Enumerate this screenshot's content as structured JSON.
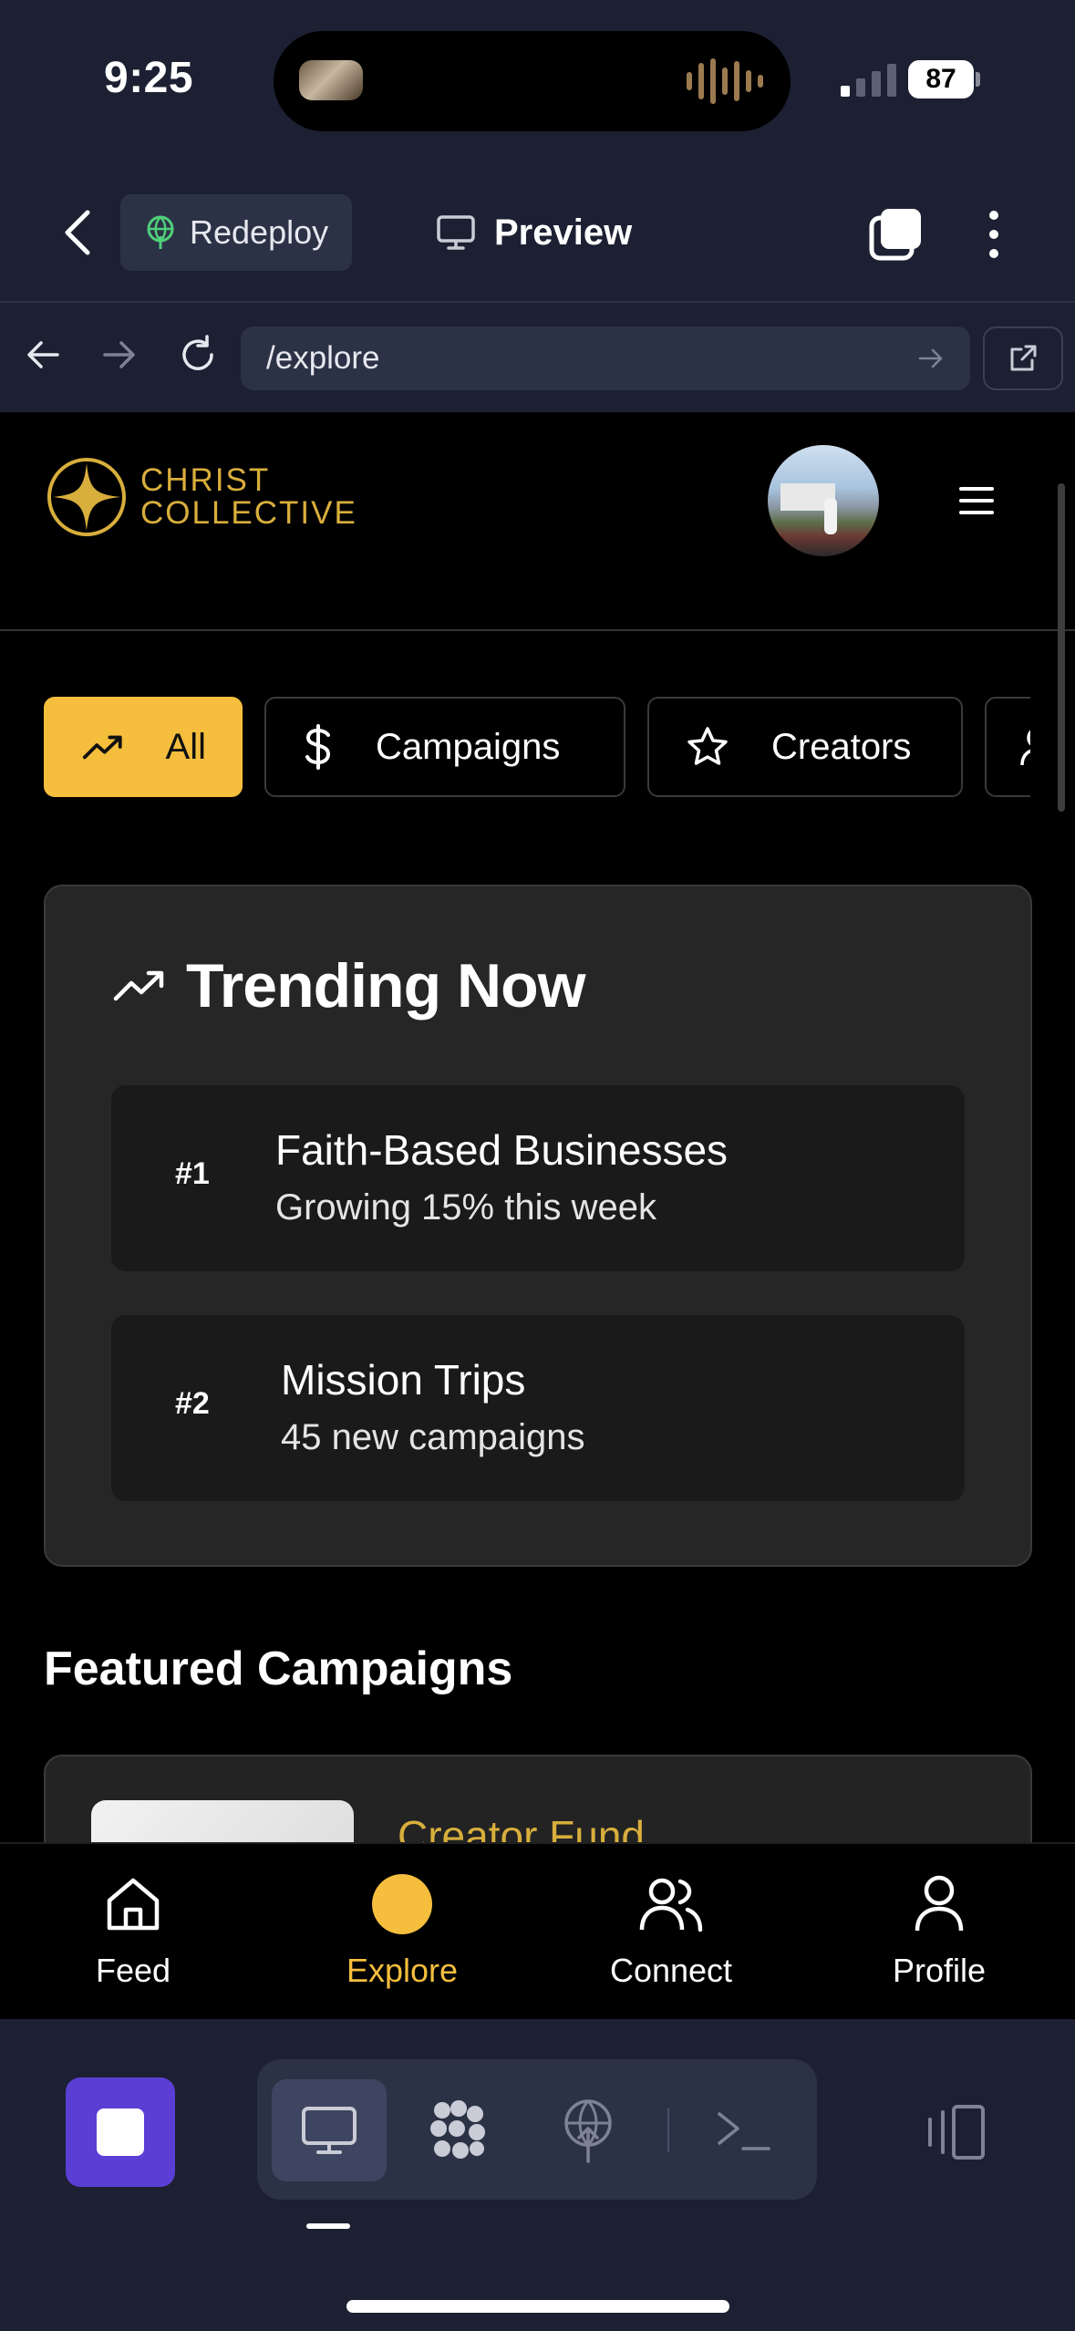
{
  "status_bar": {
    "time": "9:25",
    "battery": "87"
  },
  "topbar": {
    "redeploy_label": "Redeploy",
    "preview_label": "Preview"
  },
  "url_bar": {
    "path": "/explore"
  },
  "app": {
    "logo_line1": "CHRIST",
    "logo_line2": "COLLECTIVE",
    "brand_color": "#d8ae3c",
    "accent_color": "#f5be3d"
  },
  "filters": [
    {
      "label": "All",
      "icon": "trending-up-icon",
      "active": true
    },
    {
      "label": "Campaigns",
      "icon": "dollar-icon",
      "active": false
    },
    {
      "label": "Creators",
      "icon": "star-icon",
      "active": false
    }
  ],
  "trending": {
    "title": "Trending Now",
    "items": [
      {
        "rank": "#1",
        "name": "Faith-Based Businesses",
        "detail": "Growing 15% this week"
      },
      {
        "rank": "#2",
        "name": "Mission Trips",
        "detail": "45 new campaigns"
      }
    ]
  },
  "featured": {
    "heading": "Featured Campaigns",
    "first_card_title": "Creator Fund"
  },
  "bottom_nav": [
    {
      "label": "Feed",
      "icon": "home-icon",
      "active": false
    },
    {
      "label": "Explore",
      "icon": "explore-dot-icon",
      "active": true
    },
    {
      "label": "Connect",
      "icon": "users-icon",
      "active": false
    },
    {
      "label": "Profile",
      "icon": "user-icon",
      "active": false
    }
  ]
}
